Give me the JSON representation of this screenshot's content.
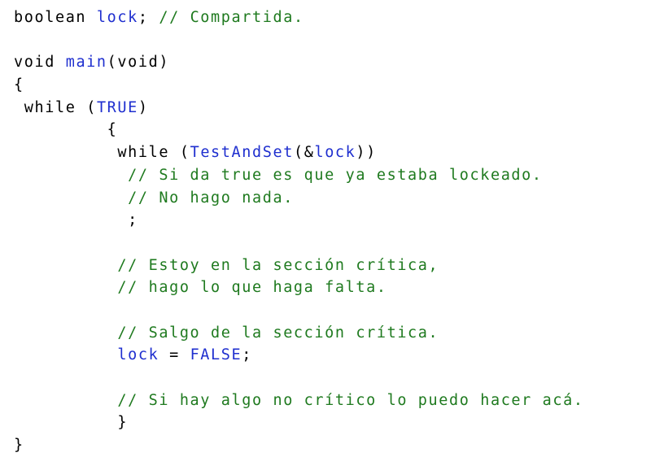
{
  "code_lines": [
    {
      "indent": "",
      "tokens": [
        {
          "t": "boolean",
          "c": "kw"
        },
        {
          "t": " ",
          "c": "pl"
        },
        {
          "t": "lock",
          "c": "id"
        },
        {
          "t": "; ",
          "c": "pl"
        },
        {
          "t": "// Compartida.",
          "c": "cm"
        }
      ]
    },
    {
      "indent": "",
      "tokens": []
    },
    {
      "indent": "",
      "tokens": [
        {
          "t": "void",
          "c": "kw"
        },
        {
          "t": " ",
          "c": "pl"
        },
        {
          "t": "main",
          "c": "id"
        },
        {
          "t": "(void)",
          "c": "pl"
        }
      ]
    },
    {
      "indent": "",
      "tokens": [
        {
          "t": "{",
          "c": "pl"
        }
      ]
    },
    {
      "indent": " ",
      "tokens": [
        {
          "t": "while",
          "c": "kw"
        },
        {
          "t": " (",
          "c": "pl"
        },
        {
          "t": "TRUE",
          "c": "id"
        },
        {
          "t": ")",
          "c": "pl"
        }
      ]
    },
    {
      "indent": "         ",
      "tokens": [
        {
          "t": "{",
          "c": "pl"
        }
      ]
    },
    {
      "indent": "          ",
      "tokens": [
        {
          "t": "while",
          "c": "kw"
        },
        {
          "t": " (",
          "c": "pl"
        },
        {
          "t": "TestAndSet",
          "c": "id"
        },
        {
          "t": "(&",
          "c": "pl"
        },
        {
          "t": "lock",
          "c": "id"
        },
        {
          "t": "))",
          "c": "pl"
        }
      ]
    },
    {
      "indent": "           ",
      "tokens": [
        {
          "t": "// Si da true es que ya estaba lockeado.",
          "c": "cm"
        }
      ]
    },
    {
      "indent": "           ",
      "tokens": [
        {
          "t": "// No hago nada.",
          "c": "cm"
        }
      ]
    },
    {
      "indent": "           ",
      "tokens": [
        {
          "t": ";",
          "c": "pl"
        }
      ]
    },
    {
      "indent": "",
      "tokens": []
    },
    {
      "indent": "          ",
      "tokens": [
        {
          "t": "// Estoy en la sección crítica,",
          "c": "cm"
        }
      ]
    },
    {
      "indent": "          ",
      "tokens": [
        {
          "t": "// hago lo que haga falta.",
          "c": "cm"
        }
      ]
    },
    {
      "indent": "",
      "tokens": []
    },
    {
      "indent": "          ",
      "tokens": [
        {
          "t": "// Salgo de la sección crítica.",
          "c": "cm"
        }
      ]
    },
    {
      "indent": "          ",
      "tokens": [
        {
          "t": "lock",
          "c": "id"
        },
        {
          "t": " = ",
          "c": "pl"
        },
        {
          "t": "FALSE",
          "c": "id"
        },
        {
          "t": ";",
          "c": "pl"
        }
      ]
    },
    {
      "indent": "",
      "tokens": []
    },
    {
      "indent": "          ",
      "tokens": [
        {
          "t": "// Si hay algo no crítico lo puedo hacer acá.",
          "c": "cm"
        }
      ]
    },
    {
      "indent": "          ",
      "tokens": [
        {
          "t": "}",
          "c": "pl"
        }
      ]
    },
    {
      "indent": "",
      "tokens": [
        {
          "t": "}",
          "c": "pl"
        }
      ]
    }
  ],
  "colors": {
    "keyword": "#000000",
    "identifier": "#1f2fcf",
    "comment": "#1f7a1f",
    "background": "#ffffff"
  }
}
